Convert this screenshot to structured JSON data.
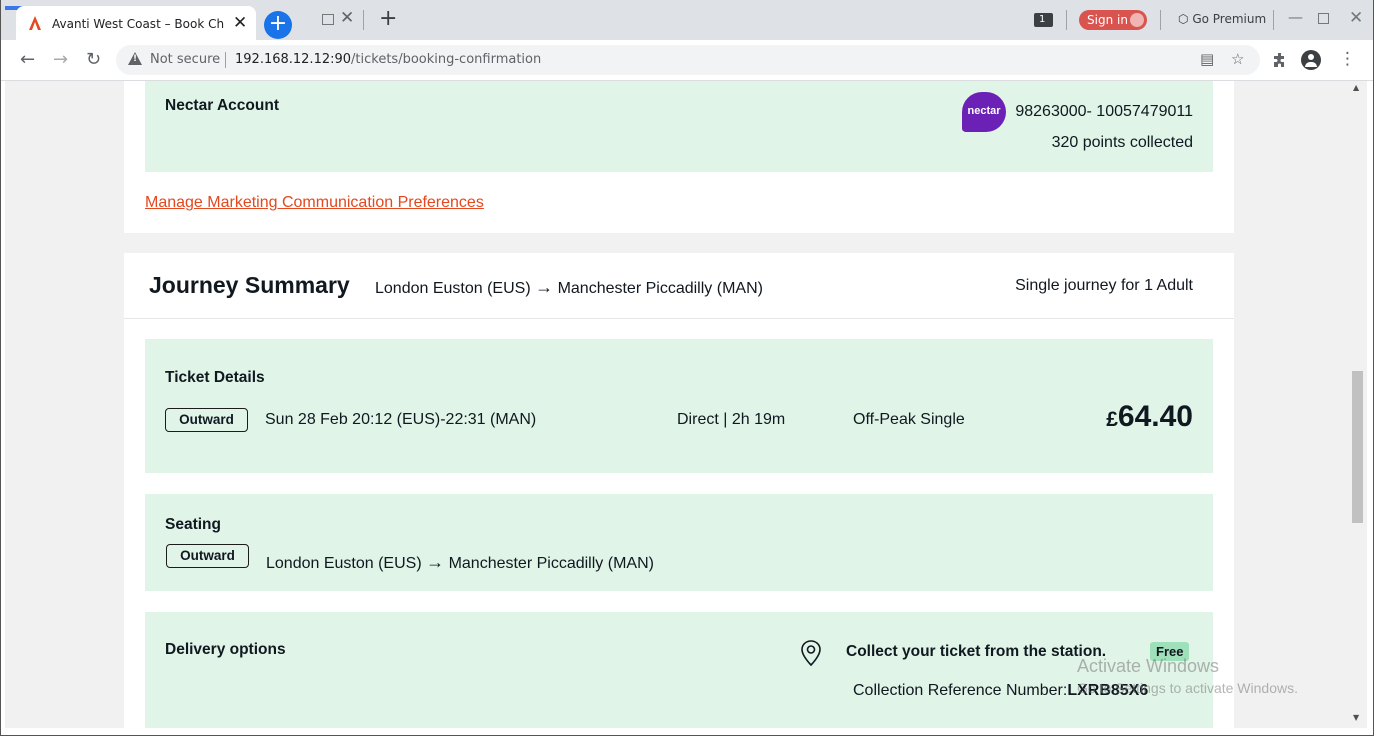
{
  "browser": {
    "tab_title": "Avanti West Coast – Book Cheap",
    "tab_count": "1",
    "sign_in_label": "Sign in",
    "go_premium_label": "Go Premium",
    "not_secure_label": "Not secure",
    "url_host": "192.168.12.12:90",
    "url_path": "/tickets/booking-confirmation"
  },
  "nectar": {
    "heading": "Nectar Account",
    "logo_text": "nectar",
    "account_number": "98263000- 10057479011",
    "points": "320 points collected"
  },
  "marketing_link": "Manage Marketing Communication Preferences",
  "journey": {
    "title": "Journey Summary",
    "origin": "London Euston (EUS)",
    "destination": "Manchester Piccadilly (MAN)",
    "summary": "Single journey for 1 Adult"
  },
  "ticket": {
    "heading": "Ticket Details",
    "direction": "Outward",
    "datetime": "Sun 28 Feb 20:12 (EUS)-22:31 (MAN)",
    "route_info": "Direct | 2h 19m",
    "fare_type": "Off-Peak Single",
    "currency": "£",
    "price": "64.40"
  },
  "seating": {
    "heading": "Seating",
    "direction": "Outward",
    "origin": "London Euston (EUS)",
    "destination": "Manchester Piccadilly (MAN)"
  },
  "delivery": {
    "heading": "Delivery options",
    "method": "Collect your ticket from the station.",
    "badge": "Free",
    "reference_label": "Collection Reference Number:",
    "reference": "LXRB85X6"
  },
  "watermark": {
    "line1": "Activate Windows",
    "line2": "Go to Settings to activate Windows."
  },
  "colors": {
    "panel_green": "#e1f4e8",
    "link_orange": "#e3481e",
    "nectar_purple": "#6b21b5",
    "free_badge": "#9ee0b9"
  }
}
